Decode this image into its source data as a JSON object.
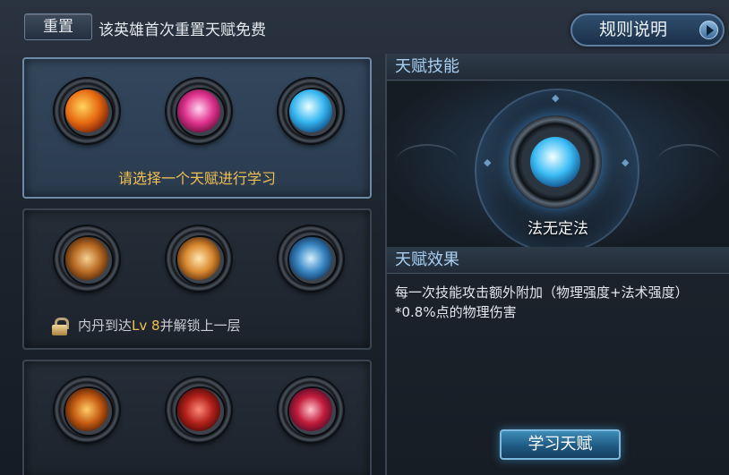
{
  "top": {
    "reset_label": "重置",
    "reset_note": "该英雄首次重置天赋免费",
    "rules_label": "规则说明"
  },
  "tiers": [
    {
      "skills": [
        "fire-fist-icon",
        "pink-sword-icon",
        "ice-blade-icon"
      ],
      "prompt": "请选择一个天赋进行学习"
    },
    {
      "skills": [
        "gun-icon",
        "golden-sword-icon",
        "blue-blade-icon"
      ],
      "lock_prefix": "内丹到达",
      "lock_level": "Lv 8",
      "lock_suffix": "并解锁上一层"
    },
    {
      "skills": [
        "cannon-icon",
        "red-spear-icon",
        "red-dragon-icon"
      ]
    }
  ],
  "detail": {
    "skill_header": "天赋技能",
    "skill_name": "法无定法",
    "effect_header": "天赋效果",
    "effect_text": "每一次技能攻击额外附加（物理强度+法术强度）*0.8%点的物理伤害",
    "learn_label": "学习天赋"
  }
}
